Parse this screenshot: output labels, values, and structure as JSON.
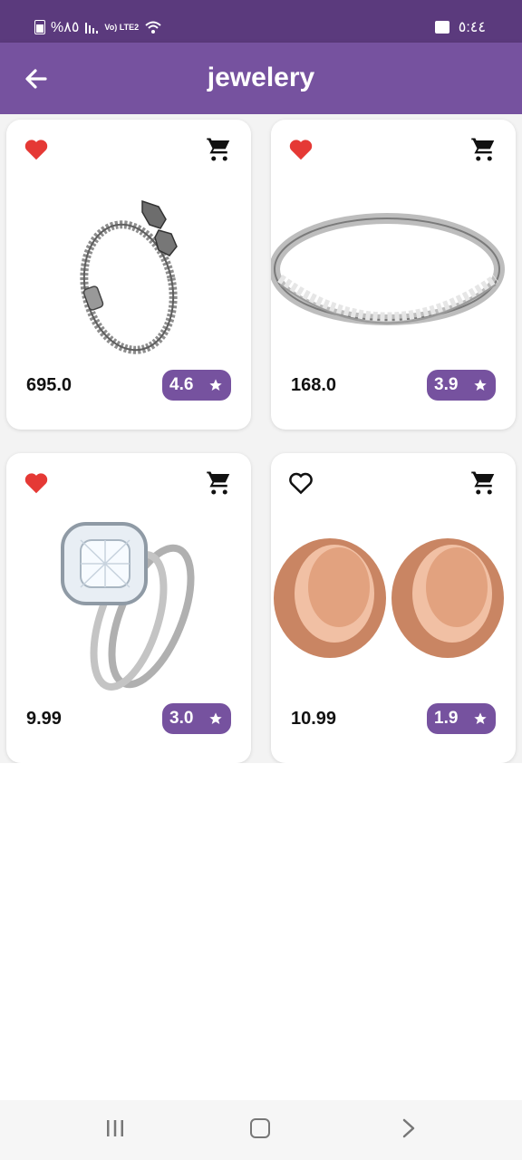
{
  "status_bar": {
    "battery": "%٨٥",
    "network": "Vo) LTE2",
    "time": "٥:٤٤"
  },
  "app_bar": {
    "title": "jewelery",
    "back_icon": "arrow-left-icon"
  },
  "colors": {
    "primary": "#76529f",
    "status_bar": "#5b3a7d",
    "favorite": "#e53935"
  },
  "products": [
    {
      "price": "695.0",
      "rating": "4.6",
      "favorite": true,
      "image": "silver-dragon-bracelet"
    },
    {
      "price": "168.0",
      "rating": "3.9",
      "favorite": true,
      "image": "silver-diamond-band-ring"
    },
    {
      "price": "9.99",
      "rating": "3.0",
      "favorite": true,
      "image": "diamond-engagement-ring-set"
    },
    {
      "price": "10.99",
      "rating": "1.9",
      "favorite": false,
      "image": "rose-gold-ear-tunnels"
    }
  ],
  "nav": {
    "recent_icon": "recent-apps-icon",
    "home_icon": "home-icon",
    "back_icon": "chevron-right-icon"
  }
}
